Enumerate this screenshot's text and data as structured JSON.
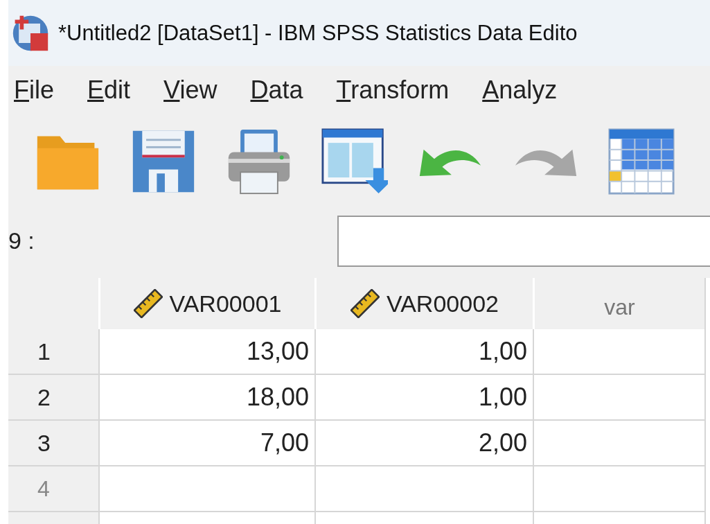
{
  "window": {
    "title": "*Untitled2 [DataSet1] - IBM SPSS Statistics Data Edito"
  },
  "menu": [
    {
      "key": "F",
      "rest": "ile"
    },
    {
      "key": "E",
      "rest": "dit"
    },
    {
      "key": "V",
      "rest": "iew"
    },
    {
      "key": "D",
      "rest": "ata"
    },
    {
      "key": "T",
      "rest": "ransform"
    },
    {
      "key": "A",
      "rest": "nalyz"
    }
  ],
  "toolbar": [
    {
      "kind": "open",
      "disabled": false
    },
    {
      "kind": "save",
      "disabled": false
    },
    {
      "kind": "print",
      "disabled": false
    },
    {
      "kind": "recall",
      "disabled": false
    },
    {
      "kind": "undo",
      "disabled": false
    },
    {
      "kind": "redo",
      "disabled": true
    },
    {
      "kind": "goto",
      "disabled": false
    }
  ],
  "cell_editor": {
    "reference": "9 :"
  },
  "grid": {
    "columns": [
      {
        "name": "VAR00001",
        "defined": true
      },
      {
        "name": "VAR00002",
        "defined": true
      },
      {
        "name": "var",
        "defined": false
      }
    ],
    "rows": [
      {
        "label": "1",
        "has_data": true,
        "cells": [
          "13,00",
          "1,00",
          ""
        ]
      },
      {
        "label": "2",
        "has_data": true,
        "cells": [
          "18,00",
          "1,00",
          ""
        ]
      },
      {
        "label": "3",
        "has_data": true,
        "cells": [
          "7,00",
          "2,00",
          ""
        ]
      },
      {
        "label": "4",
        "has_data": false,
        "cells": [
          "",
          "",
          ""
        ]
      }
    ]
  }
}
